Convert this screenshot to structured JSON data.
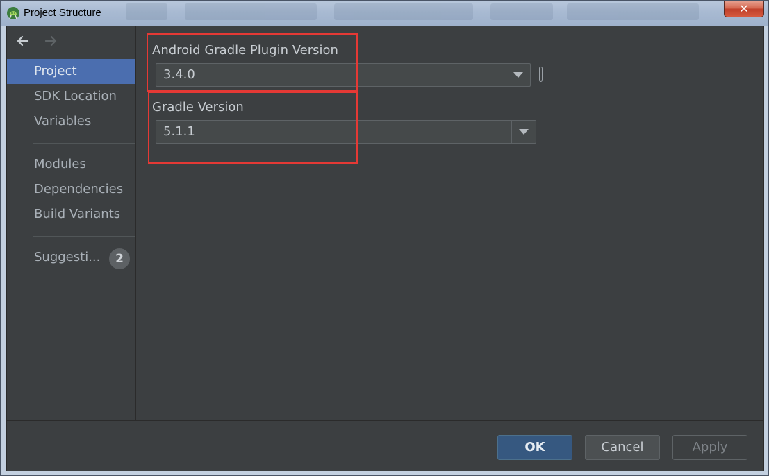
{
  "window": {
    "title": "Project Structure",
    "close_label": "✕"
  },
  "sidebar": {
    "items": [
      {
        "label": "Project",
        "selected": true
      },
      {
        "label": "SDK Location"
      },
      {
        "label": "Variables"
      },
      {
        "label": "Modules"
      },
      {
        "label": "Dependencies"
      },
      {
        "label": "Build Variants"
      },
      {
        "label": "Suggesti..."
      }
    ],
    "suggestions_count": "2"
  },
  "main": {
    "plugin_version_label": "Android Gradle Plugin Version",
    "plugin_version_value": "3.4.0",
    "gradle_version_label": "Gradle Version",
    "gradle_version_value": "5.1.1"
  },
  "footer": {
    "ok_label": "OK",
    "cancel_label": "Cancel",
    "apply_label": "Apply"
  },
  "colors": {
    "background": "#3c3f41",
    "selection": "#4b6eaf",
    "highlight_box": "#e53935",
    "ok_button": "#365880"
  },
  "icons": [
    "android-studio-icon",
    "back-arrow-icon",
    "forward-arrow-icon",
    "dropdown-arrow-icon",
    "close-icon"
  ]
}
